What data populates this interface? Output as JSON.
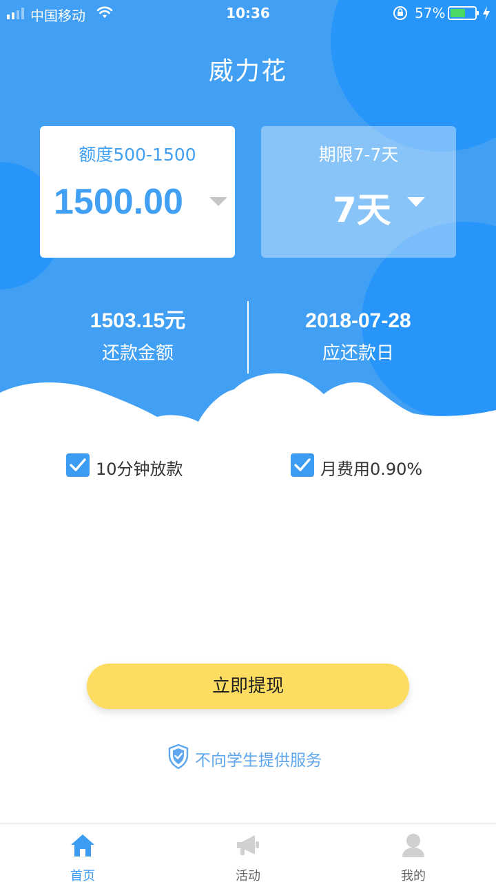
{
  "status_bar": {
    "carrier": "中国移动",
    "time": "10:36",
    "battery": "57%"
  },
  "header": {
    "title": "威力花"
  },
  "amount_card": {
    "range_label": "额度500-1500",
    "value": "1500.00"
  },
  "term_card": {
    "range_label": "期限7-7天",
    "value": "7天"
  },
  "summary": {
    "repay_amount": "1503.15元",
    "repay_amount_label": "还款金额",
    "due_date": "2018-07-28",
    "due_date_label": "应还款日"
  },
  "features": [
    {
      "label": "10分钟放款",
      "checked": true
    },
    {
      "label": "月费用0.90%",
      "checked": true
    }
  ],
  "primary_button": {
    "label": "立即提现"
  },
  "notice": {
    "text": "不向学生提供服务"
  },
  "tab_bar": {
    "items": [
      {
        "label": "首页",
        "icon": "home-icon",
        "active": true
      },
      {
        "label": "活动",
        "icon": "megaphone-icon",
        "active": false
      },
      {
        "label": "我的",
        "icon": "user-icon",
        "active": false
      }
    ]
  },
  "colors": {
    "primary_blue": "#41a0f4",
    "bubble_blue": "#2895fb",
    "button_yellow": "#fddd61",
    "tab_active": "#3c9cf2"
  }
}
